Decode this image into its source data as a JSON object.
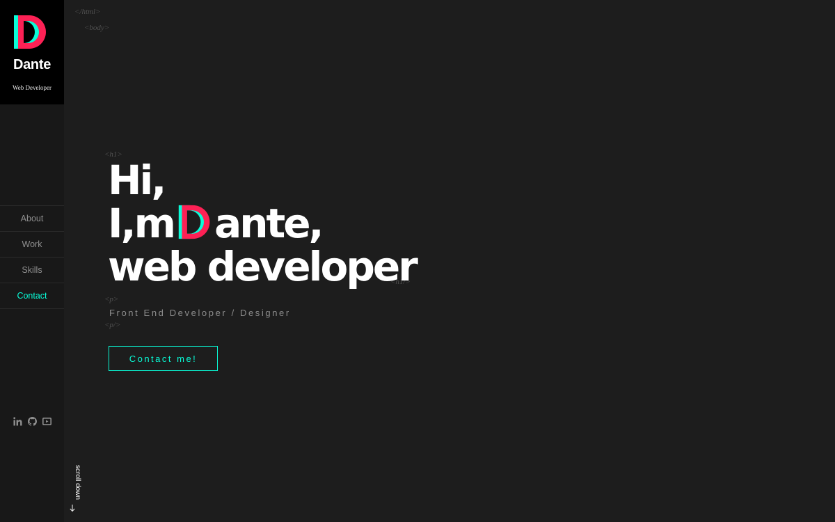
{
  "brand": {
    "name": "Dante",
    "role": "Web Developer",
    "logo_letter": "D",
    "colors": {
      "pink": "#fd2155",
      "teal": "#08fdd8"
    }
  },
  "nav": {
    "items": [
      {
        "label": "About",
        "active": false
      },
      {
        "label": "Work",
        "active": false
      },
      {
        "label": "Skills",
        "active": false
      },
      {
        "label": "Contact",
        "active": true
      }
    ]
  },
  "social": [
    {
      "name": "linkedin-icon"
    },
    {
      "name": "github-icon"
    },
    {
      "name": "youtube-icon"
    }
  ],
  "scroll_hint": {
    "label": "scroll down",
    "icon": "arrow-down-icon"
  },
  "code_tags": {
    "html_close": "</html>",
    "body_open": "<body>",
    "h1_open": "<h1>",
    "h1_close": "<h1/>",
    "p_open": "<p>",
    "p_close": "<p/>"
  },
  "hero": {
    "line1": "Hi,",
    "line2_prefix": "I,m",
    "line2_suffix": "ante,",
    "line3": "web developer",
    "subtitle": "Front End Developer / Designer",
    "cta_label": "Contact me!"
  }
}
